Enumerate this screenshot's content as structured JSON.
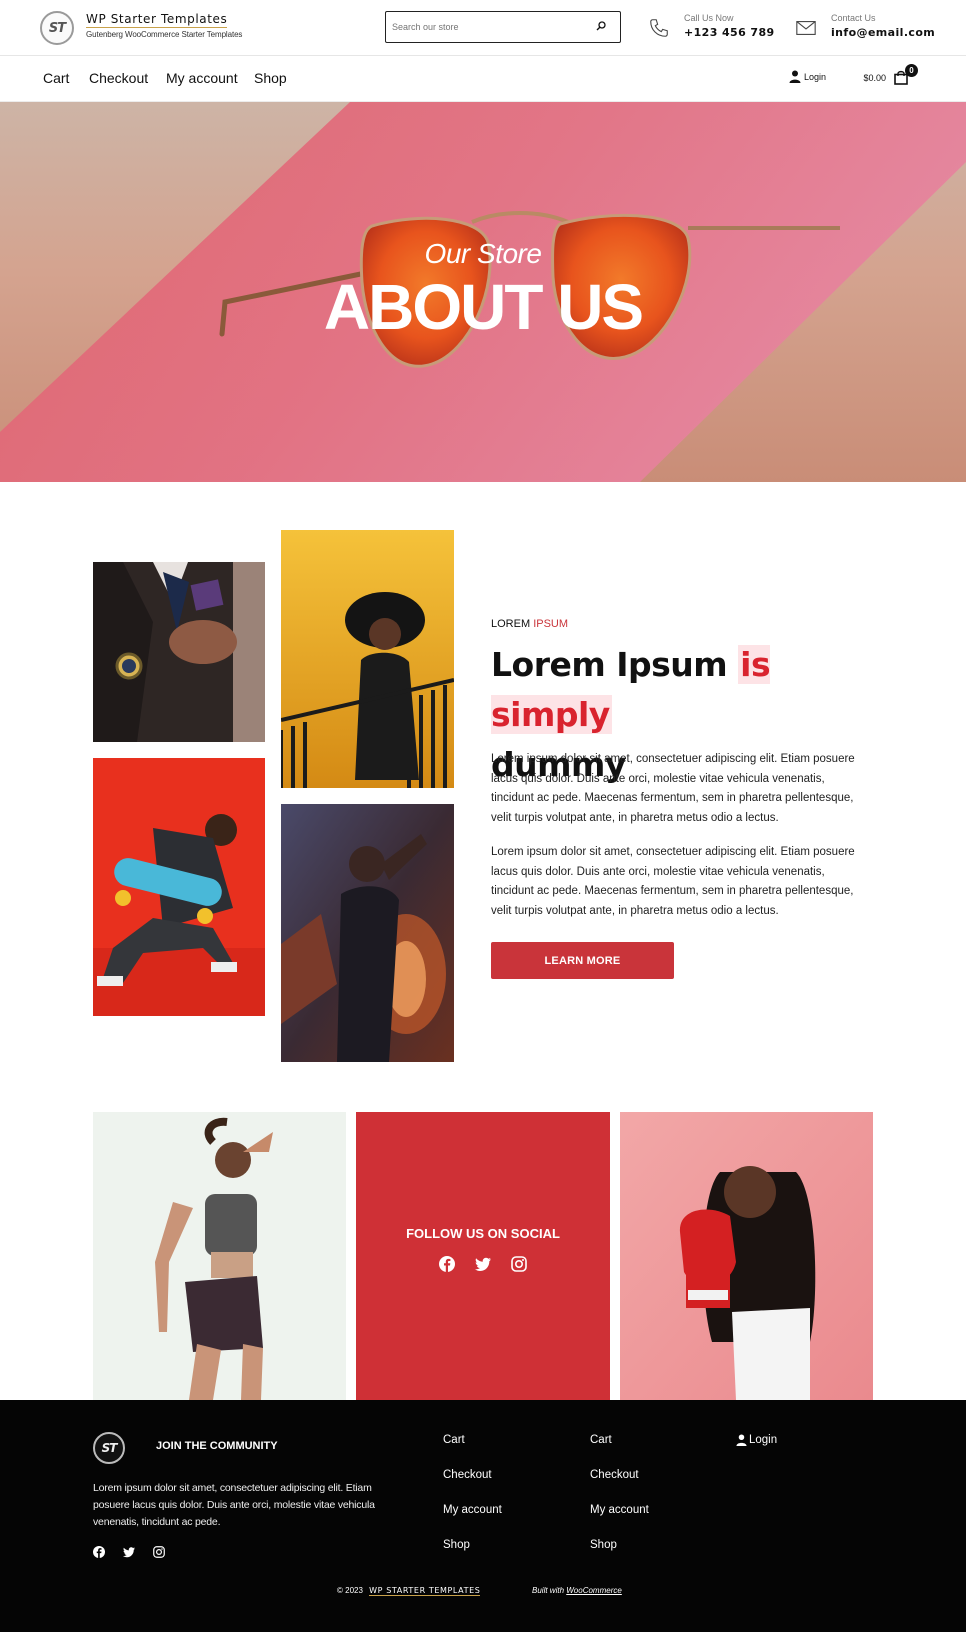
{
  "header": {
    "logo_text": "ST",
    "site_title": "WP Starter Templates",
    "site_tagline": "Gutenberg WooCommerce Starter Templates",
    "search_placeholder": "Search our store",
    "call_label": "Call Us Now",
    "call_value": "+123 456 789",
    "contact_label": "Contact Us",
    "contact_value": "info@email.com"
  },
  "nav": {
    "items": [
      "Cart",
      "Checkout",
      "My account",
      "Shop"
    ],
    "login": "Login",
    "cart_total": "$0.00",
    "cart_count": "0"
  },
  "hero": {
    "subtitle": "Our Store",
    "title": "ABOUT US"
  },
  "about": {
    "eyebrow_a": "LOREM",
    "eyebrow_b": "IPSUM",
    "heading_a": "Lorem Ipsum",
    "heading_highlight": "is simply",
    "heading_b": "dummy",
    "paragraph_1": "Lorem ipsum dolor sit amet, consectetuer adipiscing elit. Etiam posuere lacus quis dolor. Duis ante orci, molestie vitae vehicula venenatis, tincidunt ac pede. Maecenas fermentum, sem in pharetra pellentesque, velit turpis volutpat ante, in pharetra metus odio a lectus.",
    "paragraph_2": "Lorem ipsum dolor sit amet, consectetuer adipiscing elit. Etiam posuere lacus quis dolor. Duis ante orci, molestie vitae vehicula venenatis, tincidunt ac pede. Maecenas fermentum, sem in pharetra pellentesque, velit turpis volutpat ante, in pharetra metus odio a lectus.",
    "button": "LEARN MORE"
  },
  "social": {
    "title": "FOLLOW US ON SOCIAL",
    "icons": [
      "facebook-icon",
      "twitter-icon",
      "instagram-icon"
    ]
  },
  "footer": {
    "logo_text": "ST",
    "join_title": "JOIN THE COMMUNITY",
    "text": "Lorem ipsum dolor sit amet, consectetuer adipiscing elit. Etiam posuere lacus quis dolor. Duis ante orci, molestie vitae vehicula venenatis, tincidunt ac pede.",
    "col1": [
      "Cart",
      "Checkout",
      "My account",
      "Shop"
    ],
    "col2": [
      "Cart",
      "Checkout",
      "My account",
      "Shop"
    ],
    "login": "Login",
    "copyright": "© 2023",
    "brand": "WP STARTER TEMPLATES",
    "built_with": "Built with",
    "built_link": "WooCommerce"
  },
  "colors": {
    "accent_red": "#cf3036",
    "footer_bg": "#050505"
  }
}
